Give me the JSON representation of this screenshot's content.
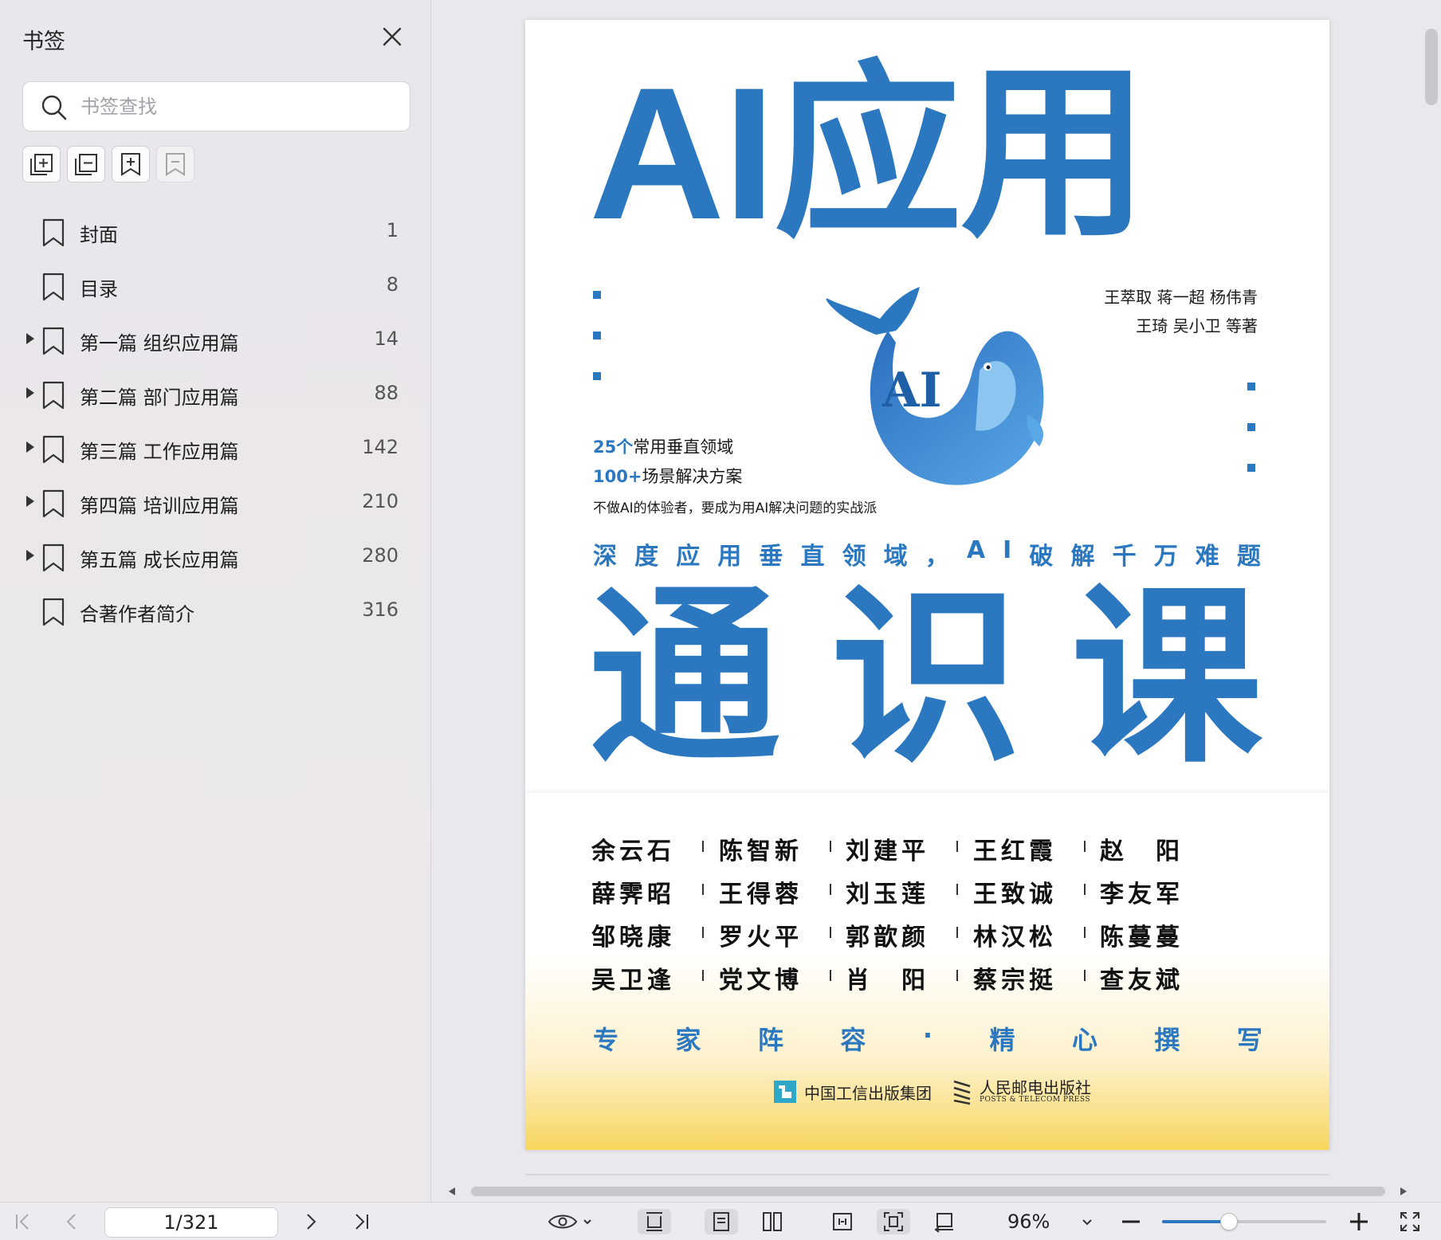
{
  "sidebar": {
    "title": "书签",
    "search_placeholder": "书签查找",
    "bookmarks": [
      {
        "label": "封面",
        "page": "1",
        "expandable": false
      },
      {
        "label": "目录",
        "page": "8",
        "expandable": false
      },
      {
        "label": "第一篇 组织应用篇",
        "page": "14",
        "expandable": true
      },
      {
        "label": "第二篇 部门应用篇",
        "page": "88",
        "expandable": true
      },
      {
        "label": "第三篇 工作应用篇",
        "page": "142",
        "expandable": true
      },
      {
        "label": "第四篇 培训应用篇",
        "page": "210",
        "expandable": true
      },
      {
        "label": "第五篇 成长应用篇",
        "page": "280",
        "expandable": true
      },
      {
        "label": "合著作者简介",
        "page": "316",
        "expandable": false
      }
    ]
  },
  "cover": {
    "title_top": "AI应用",
    "authors_line1": "王萃取 蒋一超 杨伟青",
    "authors_line2": "王琦 吴小卫  等著",
    "whale_text": "AI",
    "sub1_num": "25个",
    "sub1_text": "常用垂直领域",
    "sub2_num": "100+",
    "sub2_text": "场景解决方案",
    "sub3": "不做AI的体验者，要成为用AI解决问题的实战派",
    "tagline": "深度应用垂直领域，AI破解千万难题",
    "title_bottom": "通识课",
    "experts": [
      [
        "余云石",
        "陈智新",
        "刘建平",
        "王红霞",
        "赵　阳"
      ],
      [
        "薛霁昭",
        "王得蓉",
        "刘玉莲",
        "王致诚",
        "李友军"
      ],
      [
        "邹晓康",
        "罗火平",
        "郭歆颜",
        "林汉松",
        "陈蔓蔓"
      ],
      [
        "吴卫逢",
        "党文博",
        "肖　阳",
        "蔡宗挺",
        "查友斌"
      ]
    ],
    "slogan": "专家阵容·精心撰写",
    "publisher1": "中国工信出版集团",
    "publisher2": "人民邮电出版社",
    "publisher2_en": "POSTS & TELECOM PRESS"
  },
  "toolbar": {
    "page_indicator": "1/321",
    "zoom": "96%",
    "zoom_fraction": 0.41
  },
  "colors": {
    "accent": "#2b78c0",
    "yellow": "#f8d65e"
  }
}
